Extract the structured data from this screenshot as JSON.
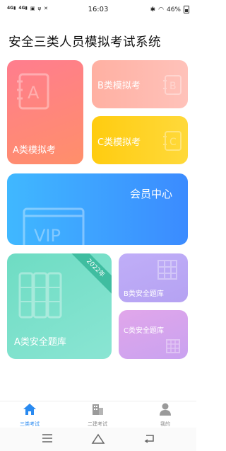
{
  "status_bar": {
    "left_signal_1": "4G",
    "left_signal_2": "4G",
    "time": "16:03",
    "battery_text": "46%"
  },
  "page": {
    "title": "安全三类人员模拟考试系统"
  },
  "cards": {
    "a_exam": {
      "label": "A类模拟考",
      "icon_letter": "A"
    },
    "b_exam": {
      "label": "B类模拟考",
      "icon_letter": "B"
    },
    "c_exam": {
      "label": "C类模拟考",
      "icon_letter": "C"
    },
    "vip": {
      "label": "会员中心",
      "icon_text": "VIP"
    },
    "a_bank": {
      "label": "A类安全题库",
      "ribbon": "2022年"
    },
    "b_bank": {
      "label": "B类安全题库"
    },
    "c_bank": {
      "label": "C类安全题库"
    }
  },
  "tabbar": {
    "items": [
      {
        "label": "三类考试",
        "icon": "home-icon",
        "active": true
      },
      {
        "label": "二建考试",
        "icon": "building-icon",
        "active": false
      },
      {
        "label": "我的",
        "icon": "user-icon",
        "active": false
      }
    ]
  },
  "colors": {
    "accent": "#2a8af0",
    "card_a": "#ff8a7a",
    "card_b": "#ffb8ad",
    "card_c": "#ffd11f",
    "card_vip": "#3d9fff",
    "card_bank_a": "#7ce1cb",
    "card_bank_b": "#bba8f5",
    "card_bank_c": "#d6a4ed"
  }
}
